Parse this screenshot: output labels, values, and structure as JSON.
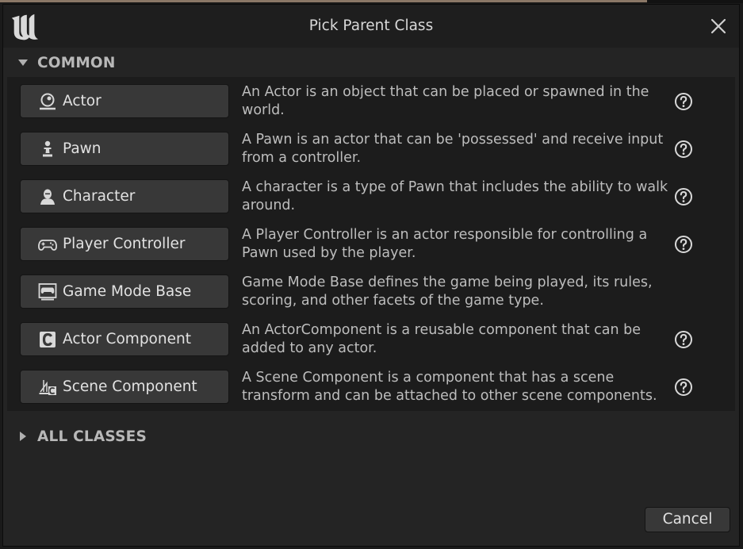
{
  "dialog": {
    "title": "Pick Parent Class",
    "close_icon": "close-icon",
    "logo": "unreal-engine-logo"
  },
  "common": {
    "header": "COMMON",
    "items": [
      {
        "label": "Actor",
        "icon": "actor-icon",
        "description": "An Actor is an object that can be placed or spawned in the world.",
        "has_help": true
      },
      {
        "label": "Pawn",
        "icon": "pawn-icon",
        "description": "A Pawn is an actor that can be 'possessed' and receive input from a controller.",
        "has_help": true
      },
      {
        "label": "Character",
        "icon": "character-icon",
        "description": "A character is a type of Pawn that includes the ability to walk around.",
        "has_help": true
      },
      {
        "label": "Player Controller",
        "icon": "gamepad-icon",
        "description": "A Player Controller is an actor responsible for controlling a Pawn used by the player.",
        "has_help": true
      },
      {
        "label": "Game Mode Base",
        "icon": "game-mode-icon",
        "description": "Game Mode Base defines the game being played, its rules, scoring, and other facets of the game type.",
        "has_help": false
      },
      {
        "label": "Actor Component",
        "icon": "actor-component-icon",
        "description": "An ActorComponent is a reusable component that can be added to any actor.",
        "has_help": true
      },
      {
        "label": "Scene Component",
        "icon": "scene-component-icon",
        "description": "A Scene Component is a component that has a scene transform and can be attached to other scene components.",
        "has_help": true
      }
    ]
  },
  "all_classes": {
    "header": "ALL CLASSES"
  },
  "footer": {
    "cancel_label": "Cancel"
  }
}
